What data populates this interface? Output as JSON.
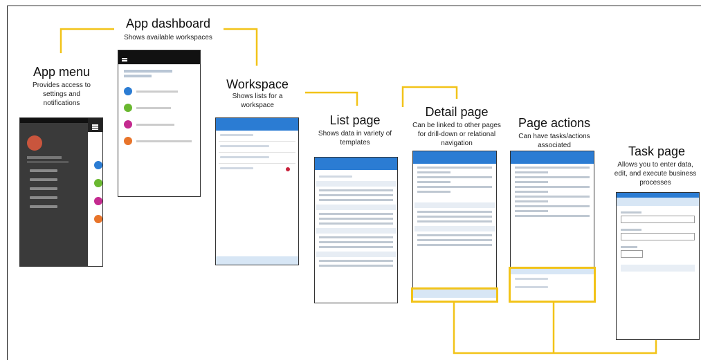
{
  "stages": [
    {
      "title": "App menu",
      "desc": "Provides access to settings and notifications"
    },
    {
      "title": "App dashboard",
      "desc": "Shows available workspaces"
    },
    {
      "title": "Workspace",
      "desc": "Shows lists for a workspace"
    },
    {
      "title": "List page",
      "desc": "Shows data in variety of templates"
    },
    {
      "title": "Detail page",
      "desc": "Can be linked to other pages for drill-down or relational navigation"
    },
    {
      "title": "Page actions",
      "desc": "Can have tasks/actions associated"
    },
    {
      "title": "Task page",
      "desc": "Allows you to enter data, edit, and execute business processes"
    }
  ],
  "colors": {
    "connector": "#f2c318",
    "accent": "#2b7cd3",
    "menu_bg": "#3a3a3a"
  },
  "icons": [
    "hamburger-icon",
    "back-arrow-icon",
    "share-icon",
    "chevron-down-icon",
    "avatar"
  ]
}
